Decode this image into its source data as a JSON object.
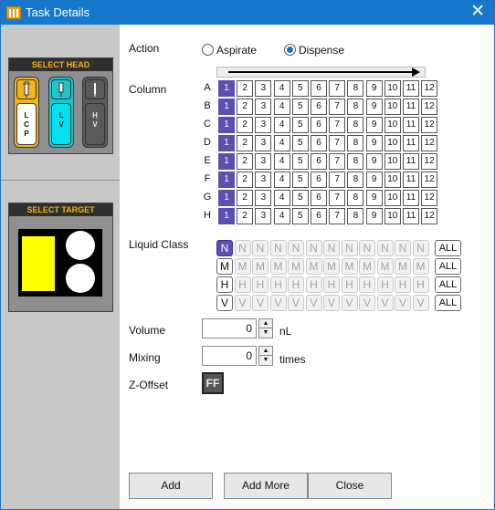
{
  "window": {
    "title": "Task Details",
    "icon": "plate-icon",
    "close_glyph": "✕"
  },
  "sidebar": {
    "select_head": {
      "title": "SELECT HEAD",
      "heads": [
        {
          "top_color": "#f4b41a",
          "bottom_label": "L C P",
          "bottom_color": "#ffffff",
          "selected": true
        },
        {
          "top_color": "#1ec6cc",
          "bottom_label": "L V",
          "bottom_color": "#00e0ee",
          "selected": false
        },
        {
          "top_color": "#5a5a5a",
          "bottom_label": "H V",
          "bottom_color": "#5a5a5a",
          "selected": false
        }
      ]
    },
    "select_target": {
      "title": "SELECT TARGET"
    }
  },
  "action": {
    "label": "Action",
    "options": [
      "Aspirate",
      "Dispense"
    ],
    "selected": "Dispense"
  },
  "column": {
    "label": "Column",
    "rows": [
      "A",
      "B",
      "C",
      "D",
      "E",
      "F",
      "G",
      "H"
    ],
    "columns": [
      "1",
      "2",
      "3",
      "4",
      "5",
      "6",
      "7",
      "8",
      "9",
      "10",
      "11",
      "12"
    ],
    "selected_column": "1"
  },
  "liquid_class": {
    "label": "Liquid Class",
    "rows": [
      {
        "letter": "N",
        "selected": true
      },
      {
        "letter": "M",
        "selected": false
      },
      {
        "letter": "H",
        "selected": false
      },
      {
        "letter": "V",
        "selected": false
      }
    ],
    "count": 12,
    "all_label": "ALL"
  },
  "volume": {
    "label": "Volume",
    "value": "0",
    "unit": "nL"
  },
  "mixing": {
    "label": "Mixing",
    "value": "0",
    "unit": "times"
  },
  "z_offset": {
    "label": "Z-Offset",
    "button": "FF"
  },
  "buttons": {
    "add": "Add",
    "add_more": "Add More",
    "close": "Close"
  },
  "colors": {
    "titlebar": "#1677cf",
    "selected": "#5b4fb0",
    "accent": "#f4b41a"
  }
}
